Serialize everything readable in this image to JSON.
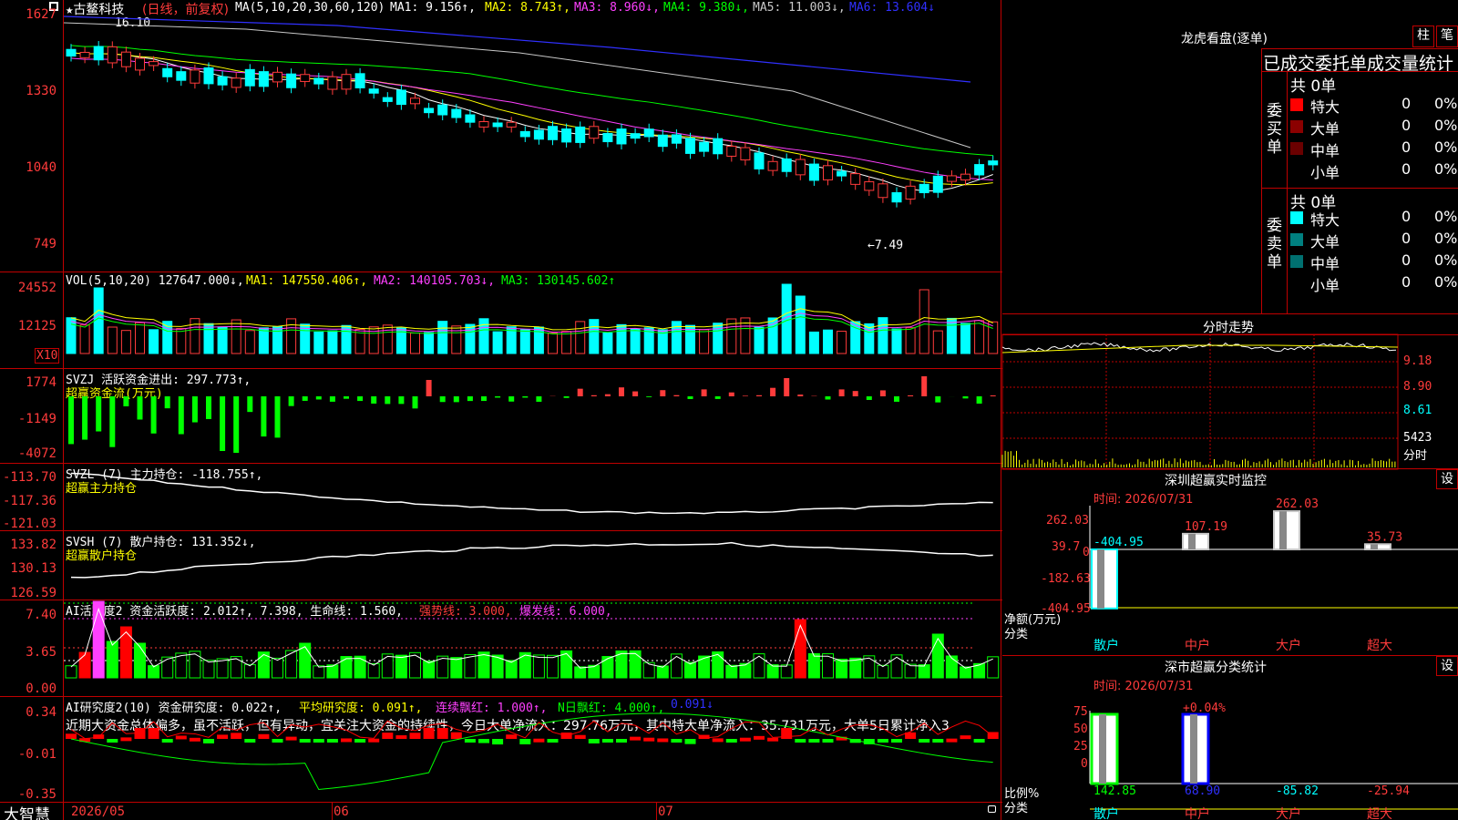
{
  "chart_header": {
    "stock_name": "★古鳌科技",
    "period": "(日线，前复权)",
    "ma_label": "MA(5,10,20,30,60,120)",
    "ma1": "MA1: 9.156↑,",
    "ma2": "MA2: 8.743↑,",
    "ma3": "MA3: 8.960↓,",
    "ma4": "MA4: 9.380↓,",
    "ma5": "MA5: 11.003↓,",
    "ma6": "MA6: 13.604↓",
    "high_mark": "16.10",
    "low_mark": "←7.49"
  },
  "price_axis": [
    "1627",
    "1330",
    "1040",
    "749"
  ],
  "vol_header": {
    "label": "VOL(5,10,20) 127647.000↓,",
    "ma1": "MA1: 147550.406↑,",
    "ma2": "MA2: 140105.703↓,",
    "ma3": "MA3: 130145.602↑"
  },
  "vol_axis": [
    "24552",
    "12125"
  ],
  "vol_multiplier": "X10",
  "svzj": {
    "line1": "SVZJ  活跃资金进出: 297.773↑,",
    "line2": "超赢资金流(万元)",
    "axis": [
      "1774",
      "-1149",
      "-4072"
    ]
  },
  "svzl": {
    "line1": "SVZL (7) 主力持仓: -118.755↑,",
    "line2": "超赢主力持仓",
    "axis": [
      "-113.70",
      "-117.36",
      "-121.03"
    ]
  },
  "svsh": {
    "line1": "SVSH (7) 散户持仓: 131.352↓,",
    "line2": "超赢散户持仓",
    "axis": [
      "133.82",
      "130.13",
      "126.59"
    ]
  },
  "ai_active": {
    "label": "AI活跃度2 资金活跃度: 2.012↑, 7.398, 生命线: 1.560,",
    "strong": "强势线: 3.000,",
    "burst": "爆发线: 6.000,",
    "axis": [
      "7.40",
      "3.65",
      "0.00"
    ]
  },
  "ai_research": {
    "label": "AI研究度2(10) 资金研究度: 0.022↑,",
    "avg": "平均研究度: 0.091↑,",
    "cont": "连续飘红: 1.000↑,",
    "nday": "N日飘红: 4.000↑,",
    "last": "0.091↓",
    "note": "近期大资金总体偏多，虽不活跃，但有异动，宜关注大资金的持续性，今日大单净流入：297.76万元，其中特大单净流入：35.731万元，大单5日累计净入3",
    "axis": [
      "0.34",
      "-0.01",
      "-0.35"
    ]
  },
  "bottom_bar": {
    "brand": "大智慧",
    "date1": "2026/05",
    "date2": "06",
    "date3": "07"
  },
  "dragon": {
    "title": "龙虎看盘(逐单)",
    "btn1": "柱",
    "btn2": "笔",
    "subtitle": "已成交委托单成交量统计",
    "buy_label": "委买单",
    "sell_label": "委卖单",
    "buy_total": "共 0单",
    "sell_total": "共 0单",
    "buy_rows": [
      {
        "name": "特大",
        "val": "0",
        "pct": "0%",
        "color": "#ff0000"
      },
      {
        "name": "大单",
        "val": "0",
        "pct": "0%",
        "color": "#8b0000"
      },
      {
        "name": "中单",
        "val": "0",
        "pct": "0%",
        "color": "#6a0000"
      },
      {
        "name": "小单",
        "val": "0",
        "pct": "0%",
        "color": "#000000"
      }
    ],
    "sell_rows": [
      {
        "name": "特大",
        "val": "0",
        "pct": "0%",
        "color": "#00ffff"
      },
      {
        "name": "大单",
        "val": "0",
        "pct": "0%",
        "color": "#008080"
      },
      {
        "name": "中单",
        "val": "0",
        "pct": "0%",
        "color": "#007070"
      },
      {
        "name": "小单",
        "val": "0",
        "pct": "0%",
        "color": "#000000"
      }
    ]
  },
  "intraday": {
    "title": "分时走势",
    "axis": [
      "9.18",
      "8.90",
      "8.61"
    ],
    "vol": "5423",
    "unit": "分时"
  },
  "sz_monitor": {
    "title": "深圳超赢实时监控",
    "btn": "设",
    "time": "时间: 2026/07/31",
    "axis": [
      "262.03",
      "39.7",
      "0",
      "-182.63",
      "-404.95"
    ],
    "unit1": "净额(万元)",
    "unit2": "分类",
    "bars": [
      {
        "name": "散户",
        "value": -404.95,
        "label": "-404.95"
      },
      {
        "name": "中户",
        "value": 107.19,
        "label": "107.19"
      },
      {
        "name": "大户",
        "value": 262.03,
        "label": "262.03"
      },
      {
        "name": "超大",
        "value": 35.73,
        "label": "35.73"
      }
    ]
  },
  "sz_stats": {
    "title": "深市超赢分类统计",
    "btn": "设",
    "time": "时间: 2026/07/31",
    "axis": [
      "75",
      "50",
      "25",
      "0"
    ],
    "pct_label": "+0.04%",
    "unit1": "比例%",
    "unit2": "分类",
    "bars": [
      {
        "name": "散户",
        "value": 142.85,
        "label": "142.85"
      },
      {
        "name": "中户",
        "value": 68.9,
        "label": "68.90"
      },
      {
        "name": "大户",
        "value": -85.82,
        "label": "-85.82"
      },
      {
        "name": "超大",
        "value": -25.94,
        "label": "-25.94"
      }
    ]
  },
  "colors": {
    "up": "#ff3b3b",
    "down": "#00ffff",
    "grid": "#c00000",
    "ma1": "#ffffff",
    "ma2": "#ffff00",
    "ma3": "#ff40ff",
    "ma4": "#00ff00",
    "ma5": "#c8c8c8",
    "ma6": "#3030ff"
  }
}
